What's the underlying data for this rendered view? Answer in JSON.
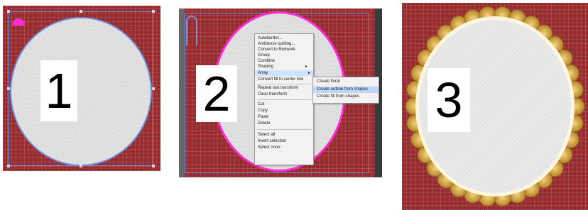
{
  "panels": [
    {
      "step_number": "1"
    },
    {
      "step_number": "2"
    },
    {
      "step_number": "3"
    }
  ],
  "context_menu": {
    "items": [
      "Autoborder...",
      "Ambience quilting...",
      "Convert to Redwork",
      "Group",
      "Combine",
      "Shaping",
      "Array",
      "Convert fill to center line",
      "Repeat last transform",
      "Clear transform",
      "Cut",
      "Copy",
      "Paste",
      "Delete",
      "Select all",
      "Invert selection",
      "Select none"
    ],
    "highlighted": "Array"
  },
  "submenu": {
    "items": [
      "Create floral",
      "Create outline from shapes",
      "Create fill from shapes"
    ],
    "highlighted": "Create outline from shapes"
  },
  "colors": {
    "grid_background": "#9a2a2d",
    "selection_outline": "#6f8fdc",
    "shape_highlight": "#ff2bd6",
    "scallop_border": "#d9a640",
    "fabric_fill": "#dcdcdc"
  }
}
